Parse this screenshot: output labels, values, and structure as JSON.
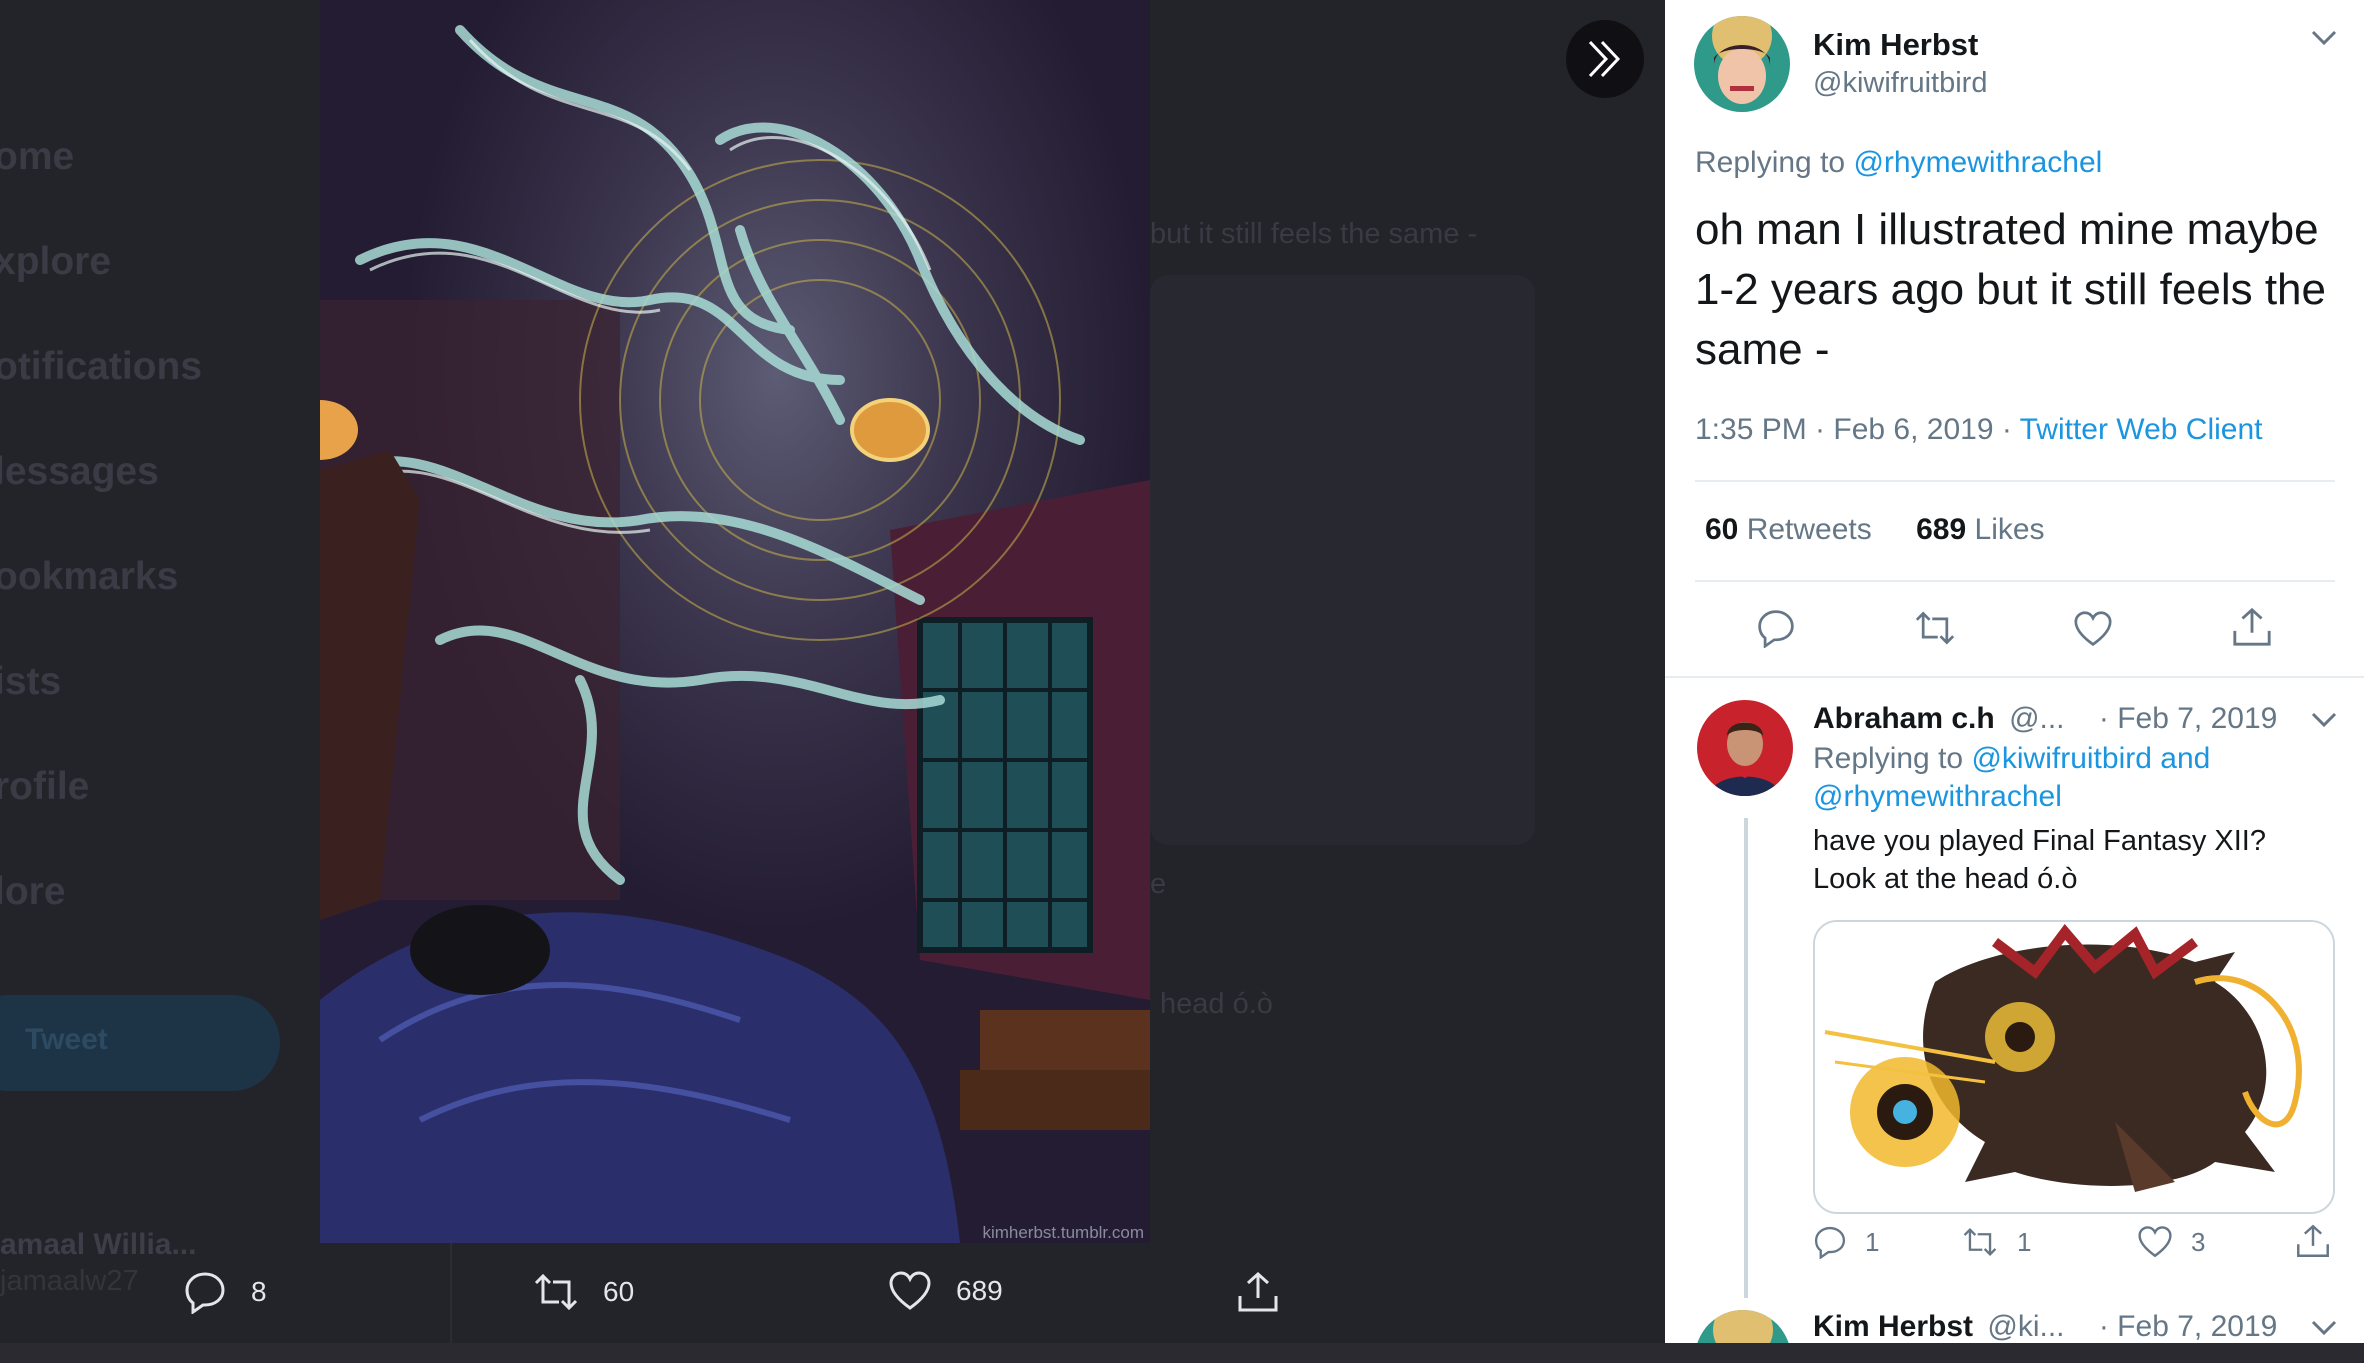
{
  "background": {
    "nav": [
      "ome",
      "xplore",
      "otifications",
      "lessages",
      "ookmarks",
      "ists",
      "rofile",
      "lore"
    ],
    "tweet_button": "Tweet",
    "user_name": "amaal Willia...",
    "user_handle": "jamaalw27",
    "snippet_1": "but it still feels the same -",
    "snippet_2": "head ó.ò",
    "snippet_3": "e"
  },
  "artwork": {
    "watermark": "kimherbst.tumblr.com"
  },
  "lightbox_actions": {
    "replies": "8",
    "retweets": "60",
    "likes": "689"
  },
  "tweet": {
    "author_name": "Kim Herbst",
    "author_handle": "@kiwifruitbird",
    "replying_prefix": "Replying to ",
    "replying_to": "@rhymewithrachel",
    "text": "oh man I illustrated mine maybe 1-2 years ago but it still feels the same -",
    "time": "1:35 PM · Feb 6, 2019 · ",
    "client": "Twitter Web Client",
    "retweet_count": "60",
    "retweet_label": " Retweets",
    "like_count": "689",
    "like_label": " Likes"
  },
  "reply": {
    "author_name": "Abraham c.h",
    "author_handle": "@...",
    "date": "· Feb 7, 2019",
    "replying_prefix": "Replying to ",
    "replying_to_1": "@kiwifruitbird and",
    "replying_to_2": "@rhymewithrachel",
    "text_line1": "have you played Final Fantasy XII?",
    "text_line2": "Look at the head ó.ò",
    "reply_count": "1",
    "retweet_count": "1",
    "like_count": "3"
  },
  "next_reply": {
    "author_name": "Kim Herbst",
    "author_handle": "@ki...",
    "date": "· Feb 7, 2019"
  },
  "colors": {
    "link": "#1b95e0",
    "muted": "#657786",
    "text": "#14171a",
    "overlay": "#23232a"
  }
}
